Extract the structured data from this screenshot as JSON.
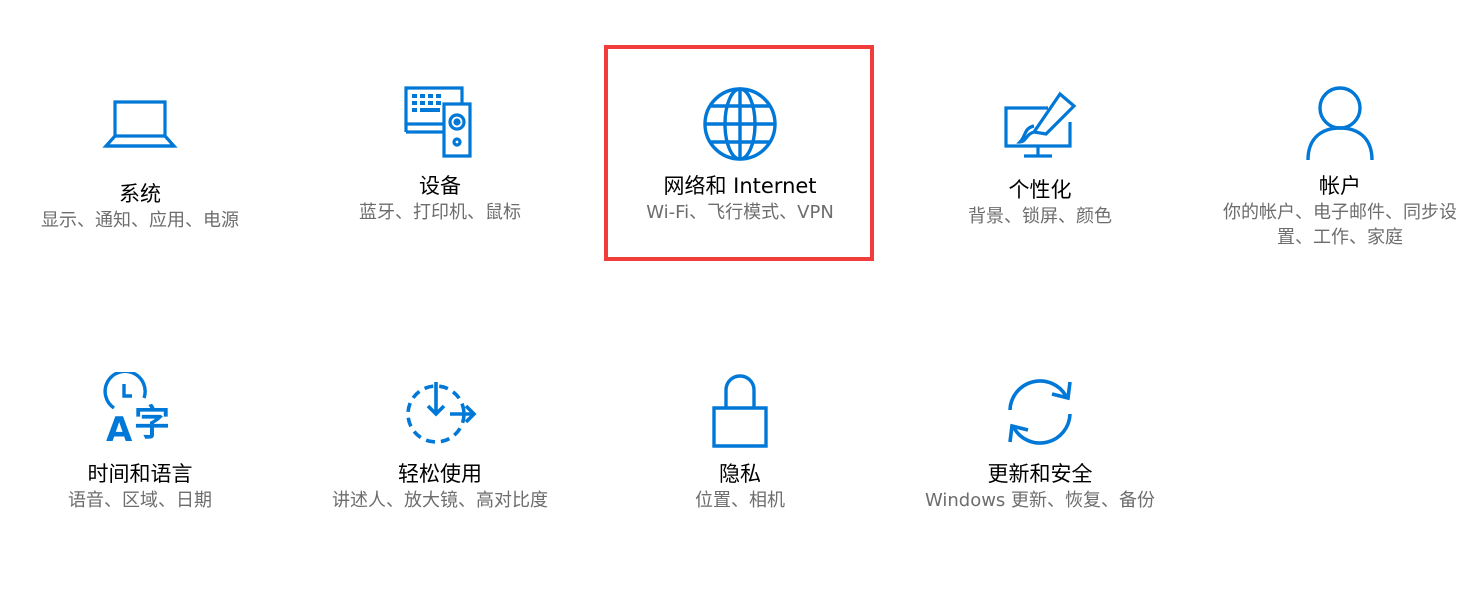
{
  "accent_color": "#0078d7",
  "highlight_color": "#f13c3c",
  "tiles": [
    {
      "icon": "laptop-icon",
      "title": "系统",
      "subtitle": "显示、通知、应用、电源"
    },
    {
      "icon": "devices-icon",
      "title": "设备",
      "subtitle": "蓝牙、打印机、鼠标"
    },
    {
      "icon": "globe-icon",
      "title": "网络和 Internet",
      "subtitle": "Wi-Fi、飞行模式、VPN"
    },
    {
      "icon": "personalization-icon",
      "title": "个性化",
      "subtitle": "背景、锁屏、颜色"
    },
    {
      "icon": "person-icon",
      "title": "帐户",
      "subtitle": "你的帐户、电子邮件、同步设置、工作、家庭"
    },
    {
      "icon": "time-language-icon",
      "title": "时间和语言",
      "subtitle": "语音、区域、日期",
      "icon_glyph": "字",
      "icon_letter": "A"
    },
    {
      "icon": "ease-of-access-icon",
      "title": "轻松使用",
      "subtitle": "讲述人、放大镜、高对比度"
    },
    {
      "icon": "lock-icon",
      "title": "隐私",
      "subtitle": "位置、相机"
    },
    {
      "icon": "sync-icon",
      "title": "更新和安全",
      "subtitle": "Windows 更新、恢复、备份"
    }
  ]
}
